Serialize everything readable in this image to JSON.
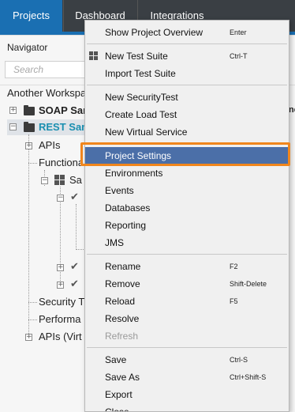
{
  "tabs": [
    {
      "label": "Projects",
      "active": true
    },
    {
      "label": "Dashboard",
      "active": false
    },
    {
      "label": "Integrations",
      "active": false
    }
  ],
  "navigator": {
    "title": "Navigator",
    "search_placeholder": "Search",
    "tree": {
      "workspace": "Another Workspac",
      "soap": "SOAP Sam",
      "rest": "REST Sam",
      "apis": "APIs",
      "functional": "Functiona",
      "sample": "Sa",
      "security": "Security T",
      "performance": "Performa",
      "apis_virt": "APIs (Virt"
    },
    "right_fragment": "ne"
  },
  "context_menu": {
    "items": [
      {
        "label": "Show Project Overview",
        "shortcut": "Enter"
      },
      {
        "label": "New Test Suite",
        "shortcut": "Ctrl-T",
        "icon": "test-suite-icon"
      },
      {
        "label": "Import Test Suite",
        "shortcut": ""
      },
      {
        "label": "New SecurityTest",
        "shortcut": ""
      },
      {
        "label": "Create Load Test",
        "shortcut": ""
      },
      {
        "label": "New Virtual Service",
        "shortcut": ""
      },
      {
        "label": "Project Settings",
        "shortcut": "",
        "highlighted": true
      },
      {
        "label": "Environments",
        "shortcut": ""
      },
      {
        "label": "Events",
        "shortcut": ""
      },
      {
        "label": "Databases",
        "shortcut": ""
      },
      {
        "label": "Reporting",
        "shortcut": ""
      },
      {
        "label": "JMS",
        "shortcut": ""
      },
      {
        "label": "Rename",
        "shortcut": "F2"
      },
      {
        "label": "Remove",
        "shortcut": "Shift-Delete"
      },
      {
        "label": "Reload",
        "shortcut": "F5"
      },
      {
        "label": "Resolve",
        "shortcut": ""
      },
      {
        "label": "Refresh",
        "shortcut": "",
        "disabled": true
      },
      {
        "label": "Save",
        "shortcut": "Ctrl-S"
      },
      {
        "label": "Save As",
        "shortcut": "Ctrl+Shift-S"
      },
      {
        "label": "Export",
        "shortcut": ""
      },
      {
        "label": "Close",
        "shortcut": ""
      }
    ]
  },
  "colors": {
    "accent": "#1a6fb2",
    "highlight": "#4b6fa8",
    "focus_outline": "#f0861d",
    "tree_selected_text": "#1a8fb0"
  }
}
